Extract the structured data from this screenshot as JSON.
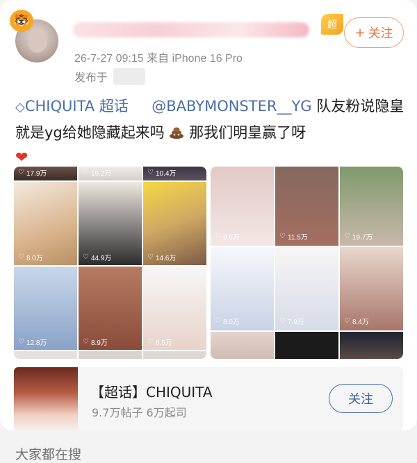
{
  "post": {
    "meta": "26-7-27 09:15  来自 iPhone 16 Pro",
    "location_label": "发布于",
    "follow_label": "关注",
    "follow_plus": "+",
    "badge_text": "超",
    "supertopic_link": "CHIQUITA 超话",
    "mention": "@BABYMONSTER__YG",
    "text_part1": " 队友粉说隐皇就是yg给她隐藏起来吗",
    "text_part2": " 那我们明皇赢了呀"
  },
  "icons": {
    "diamond": "diamond-icon",
    "heart": "heart-icon",
    "poop": "poop-emoji-icon",
    "tiger": "tiger-badge-icon"
  },
  "grid_left": {
    "likes": [
      "17.9万",
      "19.2万",
      "10.4万",
      "8.0万",
      "44.9万",
      "14.6万",
      "12.8万",
      "8.9万",
      "6.5万"
    ]
  },
  "grid_right": {
    "likes": [
      "9.6万",
      "11.5万",
      "19.7万",
      "8.0万",
      "7.9万",
      "8.4万"
    ]
  },
  "topic": {
    "title": "【超话】CHIQUITA",
    "subtitle": "9.7万帖子 6万起司",
    "follow_label": "关注"
  },
  "search_hint": "大家都在搜",
  "colors": {
    "link": "#4a6ea9",
    "follow_orange": "#e8743b",
    "heart_red": "#e5332a"
  }
}
